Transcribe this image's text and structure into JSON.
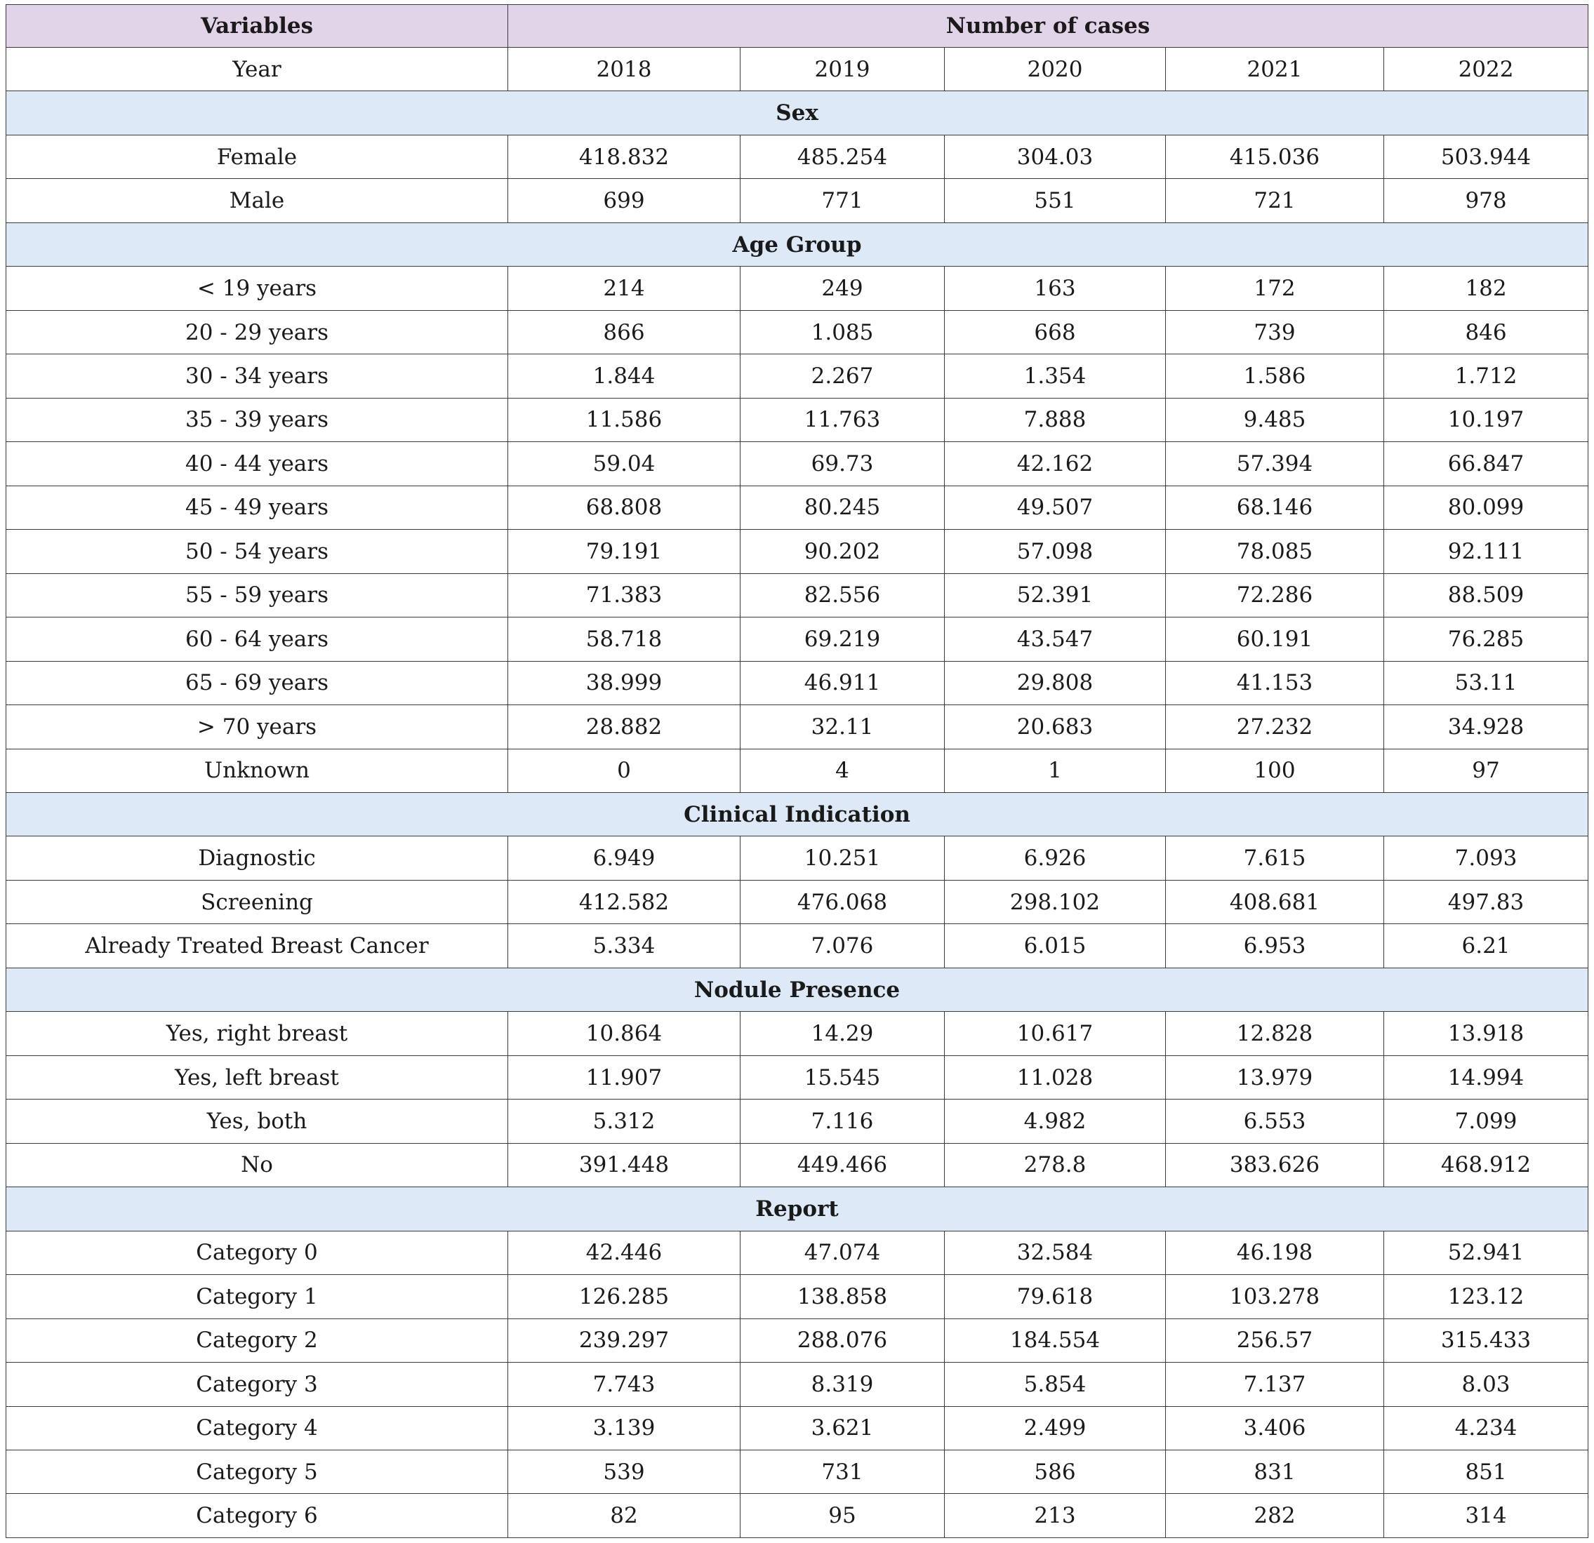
{
  "table": {
    "header": {
      "variables": "Variables",
      "number_of_cases": "Number of cases"
    },
    "year_row": {
      "label": "Year",
      "years": [
        "2018",
        "2019",
        "2020",
        "2021",
        "2022"
      ]
    },
    "sections": [
      {
        "title": "Sex",
        "rows": [
          {
            "label": "Female",
            "values": [
              "418.832",
              "485.254",
              "304.03",
              "415.036",
              "503.944"
            ]
          },
          {
            "label": "Male",
            "values": [
              "699",
              "771",
              "551",
              "721",
              "978"
            ]
          }
        ]
      },
      {
        "title": "Age Group",
        "rows": [
          {
            "label": "< 19 years",
            "values": [
              "214",
              "249",
              "163",
              "172",
              "182"
            ]
          },
          {
            "label": "20 - 29 years",
            "values": [
              "866",
              "1.085",
              "668",
              "739",
              "846"
            ]
          },
          {
            "label": "30 - 34 years",
            "values": [
              "1.844",
              "2.267",
              "1.354",
              "1.586",
              "1.712"
            ]
          },
          {
            "label": "35 - 39 years",
            "values": [
              "11.586",
              "11.763",
              "7.888",
              "9.485",
              "10.197"
            ]
          },
          {
            "label": "40 - 44 years",
            "values": [
              "59.04",
              "69.73",
              "42.162",
              "57.394",
              "66.847"
            ]
          },
          {
            "label": "45 - 49 years",
            "values": [
              "68.808",
              "80.245",
              "49.507",
              "68.146",
              "80.099"
            ]
          },
          {
            "label": "50 - 54 years",
            "values": [
              "79.191",
              "90.202",
              "57.098",
              "78.085",
              "92.111"
            ]
          },
          {
            "label": "55 - 59 years",
            "values": [
              "71.383",
              "82.556",
              "52.391",
              "72.286",
              "88.509"
            ]
          },
          {
            "label": "60 - 64 years",
            "values": [
              "58.718",
              "69.219",
              "43.547",
              "60.191",
              "76.285"
            ]
          },
          {
            "label": "65 - 69 years",
            "values": [
              "38.999",
              "46.911",
              "29.808",
              "41.153",
              "53.11"
            ]
          },
          {
            "label": "> 70 years",
            "values": [
              "28.882",
              "32.11",
              "20.683",
              "27.232",
              "34.928"
            ]
          },
          {
            "label": "Unknown",
            "values": [
              "0",
              "4",
              "1",
              "100",
              "97"
            ]
          }
        ]
      },
      {
        "title": "Clinical Indication",
        "rows": [
          {
            "label": "Diagnostic",
            "values": [
              "6.949",
              "10.251",
              "6.926",
              "7.615",
              "7.093"
            ]
          },
          {
            "label": "Screening",
            "values": [
              "412.582",
              "476.068",
              "298.102",
              "408.681",
              "497.83"
            ]
          },
          {
            "label": "Already Treated Breast Cancer",
            "values": [
              "5.334",
              "7.076",
              "6.015",
              "6.953",
              "6.21"
            ]
          }
        ]
      },
      {
        "title": "Nodule Presence",
        "rows": [
          {
            "label": "Yes, right breast",
            "values": [
              "10.864",
              "14.29",
              "10.617",
              "12.828",
              "13.918"
            ]
          },
          {
            "label": "Yes, left breast",
            "values": [
              "11.907",
              "15.545",
              "11.028",
              "13.979",
              "14.994"
            ]
          },
          {
            "label": "Yes, both",
            "values": [
              "5.312",
              "7.116",
              "4.982",
              "6.553",
              "7.099"
            ]
          },
          {
            "label": "No",
            "values": [
              "391.448",
              "449.466",
              "278.8",
              "383.626",
              "468.912"
            ]
          }
        ]
      },
      {
        "title": "Report",
        "rows": [
          {
            "label": "Category 0",
            "values": [
              "42.446",
              "47.074",
              "32.584",
              "46.198",
              "52.941"
            ]
          },
          {
            "label": "Category 1",
            "values": [
              "126.285",
              "138.858",
              "79.618",
              "103.278",
              "123.12"
            ]
          },
          {
            "label": "Category 2",
            "values": [
              "239.297",
              "288.076",
              "184.554",
              "256.57",
              "315.433"
            ]
          },
          {
            "label": "Category 3",
            "values": [
              "7.743",
              "8.319",
              "5.854",
              "7.137",
              "8.03"
            ]
          },
          {
            "label": "Category 4",
            "values": [
              "3.139",
              "3.621",
              "2.499",
              "3.406",
              "4.234"
            ]
          },
          {
            "label": "Category 5",
            "values": [
              "539",
              "731",
              "586",
              "831",
              "851"
            ]
          },
          {
            "label": "Category 6",
            "values": [
              "82",
              "95",
              "213",
              "282",
              "314"
            ]
          }
        ]
      }
    ]
  }
}
